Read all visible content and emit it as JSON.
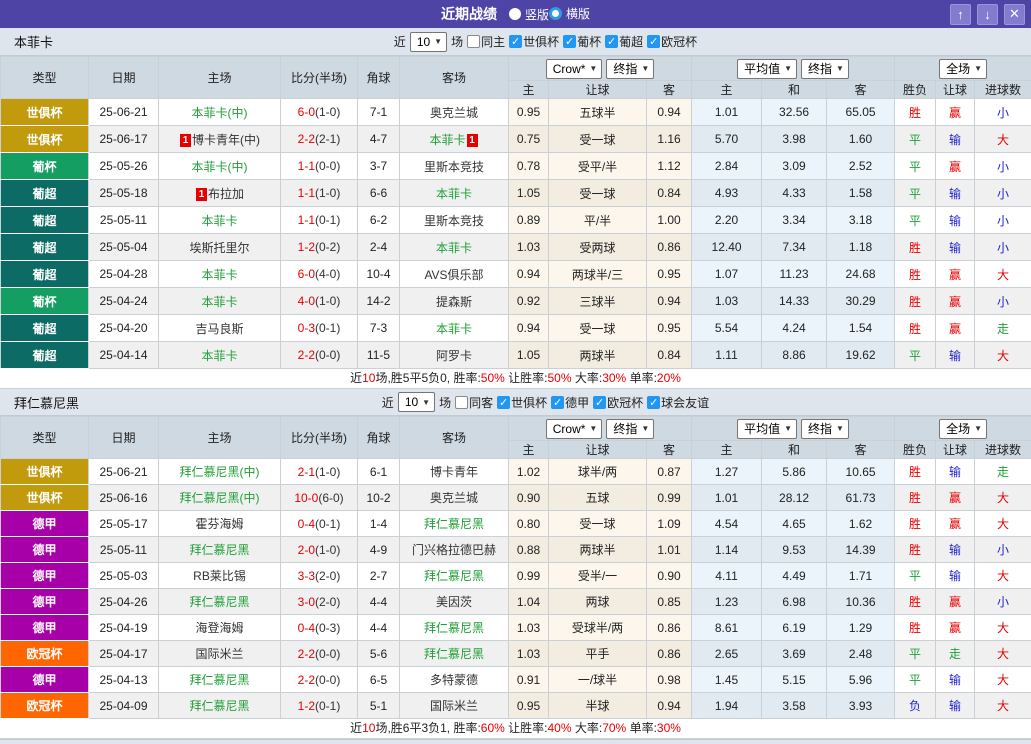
{
  "titlebar": {
    "title": "近期战绩",
    "radios": [
      {
        "label": "竖版",
        "checked": false
      },
      {
        "label": "横版",
        "checked": true
      }
    ],
    "buttons": {
      "up": "↑",
      "down": "↓",
      "close": "✕"
    }
  },
  "colors": {
    "titlebar_bg": "#4D44A5",
    "leagues": {
      "世俱杯": "#C29B0C",
      "葡杯": "#149E62",
      "葡超": "#0C6C65",
      "德甲": "#A800A8",
      "欧冠杯": "#FF6600"
    },
    "result_classes": {
      "胜": "c-red",
      "赢": "c-red",
      "大": "c-red",
      "平": "c-green",
      "走": "c-green",
      "负": "c-blue",
      "输": "c-blue",
      "小": "c-blue"
    },
    "focus_team_color": "#22A038",
    "score_color": "#E60000",
    "checkbox_color": "#2196F3"
  },
  "sections": [
    {
      "team": "本菲卡",
      "filter": {
        "prefix": "近",
        "count": "10",
        "suffix": "场",
        "checkboxes": [
          {
            "label": "同主",
            "checked": false
          },
          {
            "label": "世俱杯",
            "checked": true
          },
          {
            "label": "葡杯",
            "checked": true
          },
          {
            "label": "葡超",
            "checked": true
          },
          {
            "label": "欧冠杯",
            "checked": true
          }
        ]
      },
      "header": {
        "cols": [
          "类型",
          "日期",
          "主场",
          "比分(半场)",
          "角球",
          "客场"
        ],
        "odds_source_select": "Crow*",
        "odds_time_select": "终指",
        "odds_sub": [
          "主",
          "让球",
          "客"
        ],
        "avg_source_select": "平均值",
        "avg_time_select": "终指",
        "avg_sub": [
          "主",
          "和",
          "客"
        ],
        "scope_select": "全场",
        "result_sub": [
          "胜负",
          "让球",
          "进球数"
        ]
      },
      "rows": [
        {
          "league": "世俱杯",
          "date": "25-06-21",
          "home": {
            "name": "本菲卡(中)",
            "focus": true
          },
          "score": "6-0",
          "half": "(1-0)",
          "corner": "7-1",
          "away": {
            "name": "奥克兰城"
          },
          "odds": [
            "0.95",
            "五球半",
            "0.94"
          ],
          "avg": [
            "1.01",
            "32.56",
            "65.05"
          ],
          "result": [
            "胜",
            "赢",
            "小"
          ]
        },
        {
          "league": "世俱杯",
          "date": "25-06-17",
          "home": {
            "badge_before": "1",
            "name": "博卡青年(中)"
          },
          "score": "2-2",
          "half": "(2-1)",
          "corner": "4-7",
          "away": {
            "name": "本菲卡",
            "focus": true,
            "badge_after": "1"
          },
          "odds": [
            "0.75",
            "受一球",
            "1.16"
          ],
          "avg": [
            "5.70",
            "3.98",
            "1.60"
          ],
          "result": [
            "平",
            "输",
            "大"
          ]
        },
        {
          "league": "葡杯",
          "date": "25-05-26",
          "home": {
            "name": "本菲卡(中)",
            "focus": true
          },
          "score": "1-1",
          "half": "(0-0)",
          "corner": "3-7",
          "away": {
            "name": "里斯本竞技"
          },
          "odds": [
            "0.78",
            "受平/半",
            "1.12"
          ],
          "avg": [
            "2.84",
            "3.09",
            "2.52"
          ],
          "result": [
            "平",
            "赢",
            "小"
          ]
        },
        {
          "league": "葡超",
          "date": "25-05-18",
          "home": {
            "badge_before": "1",
            "name": "布拉加"
          },
          "score": "1-1",
          "half": "(1-0)",
          "corner": "6-6",
          "away": {
            "name": "本菲卡",
            "focus": true
          },
          "odds": [
            "1.05",
            "受一球",
            "0.84"
          ],
          "avg": [
            "4.93",
            "4.33",
            "1.58"
          ],
          "result": [
            "平",
            "输",
            "小"
          ]
        },
        {
          "league": "葡超",
          "date": "25-05-11",
          "home": {
            "name": "本菲卡",
            "focus": true
          },
          "score": "1-1",
          "half": "(0-1)",
          "corner": "6-2",
          "away": {
            "name": "里斯本竞技"
          },
          "odds": [
            "0.89",
            "平/半",
            "1.00"
          ],
          "avg": [
            "2.20",
            "3.34",
            "3.18"
          ],
          "result": [
            "平",
            "输",
            "小"
          ]
        },
        {
          "league": "葡超",
          "date": "25-05-04",
          "home": {
            "name": "埃斯托里尔"
          },
          "score": "1-2",
          "half": "(0-2)",
          "corner": "2-4",
          "away": {
            "name": "本菲卡",
            "focus": true
          },
          "odds": [
            "1.03",
            "受两球",
            "0.86"
          ],
          "avg": [
            "12.40",
            "7.34",
            "1.18"
          ],
          "result": [
            "胜",
            "输",
            "小"
          ]
        },
        {
          "league": "葡超",
          "date": "25-04-28",
          "home": {
            "name": "本菲卡",
            "focus": true
          },
          "score": "6-0",
          "half": "(4-0)",
          "corner": "10-4",
          "away": {
            "name": "AVS俱乐部"
          },
          "odds": [
            "0.94",
            "两球半/三",
            "0.95"
          ],
          "avg": [
            "1.07",
            "11.23",
            "24.68"
          ],
          "result": [
            "胜",
            "赢",
            "大"
          ]
        },
        {
          "league": "葡杯",
          "date": "25-04-24",
          "home": {
            "name": "本菲卡",
            "focus": true
          },
          "score": "4-0",
          "half": "(1-0)",
          "corner": "14-2",
          "away": {
            "name": "提森斯"
          },
          "odds": [
            "0.92",
            "三球半",
            "0.94"
          ],
          "avg": [
            "1.03",
            "14.33",
            "30.29"
          ],
          "result": [
            "胜",
            "赢",
            "小"
          ]
        },
        {
          "league": "葡超",
          "date": "25-04-20",
          "home": {
            "name": "吉马良斯"
          },
          "score": "0-3",
          "half": "(0-1)",
          "corner": "7-3",
          "away": {
            "name": "本菲卡",
            "focus": true
          },
          "odds": [
            "0.94",
            "受一球",
            "0.95"
          ],
          "avg": [
            "5.54",
            "4.24",
            "1.54"
          ],
          "result": [
            "胜",
            "赢",
            "走"
          ]
        },
        {
          "league": "葡超",
          "date": "25-04-14",
          "home": {
            "name": "本菲卡",
            "focus": true
          },
          "score": "2-2",
          "half": "(0-0)",
          "corner": "11-5",
          "away": {
            "name": "阿罗卡"
          },
          "odds": [
            "1.05",
            "两球半",
            "0.84"
          ],
          "avg": [
            "1.11",
            "8.86",
            "19.62"
          ],
          "result": [
            "平",
            "输",
            "大"
          ]
        }
      ],
      "summary": [
        {
          "t": "近",
          "red": false
        },
        {
          "t": "10",
          "red": true
        },
        {
          "t": "场,胜5平5负0, 胜率:",
          "red": false
        },
        {
          "t": "50%",
          "red": true
        },
        {
          "t": " 让胜率:",
          "red": false
        },
        {
          "t": "50%",
          "red": true
        },
        {
          "t": " 大率:",
          "red": false
        },
        {
          "t": "30%",
          "red": true
        },
        {
          "t": " 单率:",
          "red": false
        },
        {
          "t": "20%",
          "red": true
        }
      ]
    },
    {
      "team": "拜仁慕尼黑",
      "filter": {
        "prefix": "近",
        "count": "10",
        "suffix": "场",
        "checkboxes": [
          {
            "label": "同客",
            "checked": false
          },
          {
            "label": "世俱杯",
            "checked": true
          },
          {
            "label": "德甲",
            "checked": true
          },
          {
            "label": "欧冠杯",
            "checked": true
          },
          {
            "label": "球会友谊",
            "checked": true
          }
        ]
      },
      "header": {
        "cols": [
          "类型",
          "日期",
          "主场",
          "比分(半场)",
          "角球",
          "客场"
        ],
        "odds_source_select": "Crow*",
        "odds_time_select": "终指",
        "odds_sub": [
          "主",
          "让球",
          "客"
        ],
        "avg_source_select": "平均值",
        "avg_time_select": "终指",
        "avg_sub": [
          "主",
          "和",
          "客"
        ],
        "scope_select": "全场",
        "result_sub": [
          "胜负",
          "让球",
          "进球数"
        ]
      },
      "rows": [
        {
          "league": "世俱杯",
          "date": "25-06-21",
          "home": {
            "name": "拜仁慕尼黑(中)",
            "focus": true
          },
          "score": "2-1",
          "half": "(1-0)",
          "corner": "6-1",
          "away": {
            "name": "博卡青年"
          },
          "odds": [
            "1.02",
            "球半/两",
            "0.87"
          ],
          "avg": [
            "1.27",
            "5.86",
            "10.65"
          ],
          "result": [
            "胜",
            "输",
            "走"
          ]
        },
        {
          "league": "世俱杯",
          "date": "25-06-16",
          "home": {
            "name": "拜仁慕尼黑(中)",
            "focus": true
          },
          "score": "10-0",
          "half": "(6-0)",
          "corner": "10-2",
          "away": {
            "name": "奥克兰城"
          },
          "odds": [
            "0.90",
            "五球",
            "0.99"
          ],
          "avg": [
            "1.01",
            "28.12",
            "61.73"
          ],
          "result": [
            "胜",
            "赢",
            "大"
          ]
        },
        {
          "league": "德甲",
          "date": "25-05-17",
          "home": {
            "name": "霍芬海姆"
          },
          "score": "0-4",
          "half": "(0-1)",
          "corner": "1-4",
          "away": {
            "name": "拜仁慕尼黑",
            "focus": true
          },
          "odds": [
            "0.80",
            "受一球",
            "1.09"
          ],
          "avg": [
            "4.54",
            "4.65",
            "1.62"
          ],
          "result": [
            "胜",
            "赢",
            "大"
          ]
        },
        {
          "league": "德甲",
          "date": "25-05-11",
          "home": {
            "name": "拜仁慕尼黑",
            "focus": true
          },
          "score": "2-0",
          "half": "(1-0)",
          "corner": "4-9",
          "away": {
            "name": "门兴格拉德巴赫"
          },
          "odds": [
            "0.88",
            "两球半",
            "1.01"
          ],
          "avg": [
            "1.14",
            "9.53",
            "14.39"
          ],
          "result": [
            "胜",
            "输",
            "小"
          ]
        },
        {
          "league": "德甲",
          "date": "25-05-03",
          "home": {
            "name": "RB莱比锡"
          },
          "score": "3-3",
          "half": "(2-0)",
          "corner": "2-7",
          "away": {
            "name": "拜仁慕尼黑",
            "focus": true
          },
          "odds": [
            "0.99",
            "受半/一",
            "0.90"
          ],
          "avg": [
            "4.11",
            "4.49",
            "1.71"
          ],
          "result": [
            "平",
            "输",
            "大"
          ]
        },
        {
          "league": "德甲",
          "date": "25-04-26",
          "home": {
            "name": "拜仁慕尼黑",
            "focus": true
          },
          "score": "3-0",
          "half": "(2-0)",
          "corner": "4-4",
          "away": {
            "name": "美因茨"
          },
          "odds": [
            "1.04",
            "两球",
            "0.85"
          ],
          "avg": [
            "1.23",
            "6.98",
            "10.36"
          ],
          "result": [
            "胜",
            "赢",
            "小"
          ]
        },
        {
          "league": "德甲",
          "date": "25-04-19",
          "home": {
            "name": "海登海姆"
          },
          "score": "0-4",
          "half": "(0-3)",
          "corner": "4-4",
          "away": {
            "name": "拜仁慕尼黑",
            "focus": true
          },
          "odds": [
            "1.03",
            "受球半/两",
            "0.86"
          ],
          "avg": [
            "8.61",
            "6.19",
            "1.29"
          ],
          "result": [
            "胜",
            "赢",
            "大"
          ]
        },
        {
          "league": "欧冠杯",
          "date": "25-04-17",
          "home": {
            "name": "国际米兰"
          },
          "score": "2-2",
          "half": "(0-0)",
          "corner": "5-6",
          "away": {
            "name": "拜仁慕尼黑",
            "focus": true
          },
          "odds": [
            "1.03",
            "平手",
            "0.86"
          ],
          "avg": [
            "2.65",
            "3.69",
            "2.48"
          ],
          "result": [
            "平",
            "走",
            "大"
          ]
        },
        {
          "league": "德甲",
          "date": "25-04-13",
          "home": {
            "name": "拜仁慕尼黑",
            "focus": true
          },
          "score": "2-2",
          "half": "(0-0)",
          "corner": "6-5",
          "away": {
            "name": "多特蒙德"
          },
          "odds": [
            "0.91",
            "一/球半",
            "0.98"
          ],
          "avg": [
            "1.45",
            "5.15",
            "5.96"
          ],
          "result": [
            "平",
            "输",
            "大"
          ]
        },
        {
          "league": "欧冠杯",
          "date": "25-04-09",
          "home": {
            "name": "拜仁慕尼黑",
            "focus": true
          },
          "score": "1-2",
          "half": "(0-1)",
          "corner": "5-1",
          "away": {
            "name": "国际米兰"
          },
          "odds": [
            "0.95",
            "半球",
            "0.94"
          ],
          "avg": [
            "1.94",
            "3.58",
            "3.93"
          ],
          "result": [
            "负",
            "输",
            "大"
          ]
        }
      ],
      "summary": [
        {
          "t": "近",
          "red": false
        },
        {
          "t": "10",
          "red": true
        },
        {
          "t": "场,胜6平3负1, 胜率:",
          "red": false
        },
        {
          "t": "60%",
          "red": true
        },
        {
          "t": " 让胜率:",
          "red": false
        },
        {
          "t": "40%",
          "red": true
        },
        {
          "t": " 大率:",
          "red": false
        },
        {
          "t": "70%",
          "red": true
        },
        {
          "t": " 单率:",
          "red": false
        },
        {
          "t": "30%",
          "red": true
        }
      ]
    }
  ]
}
